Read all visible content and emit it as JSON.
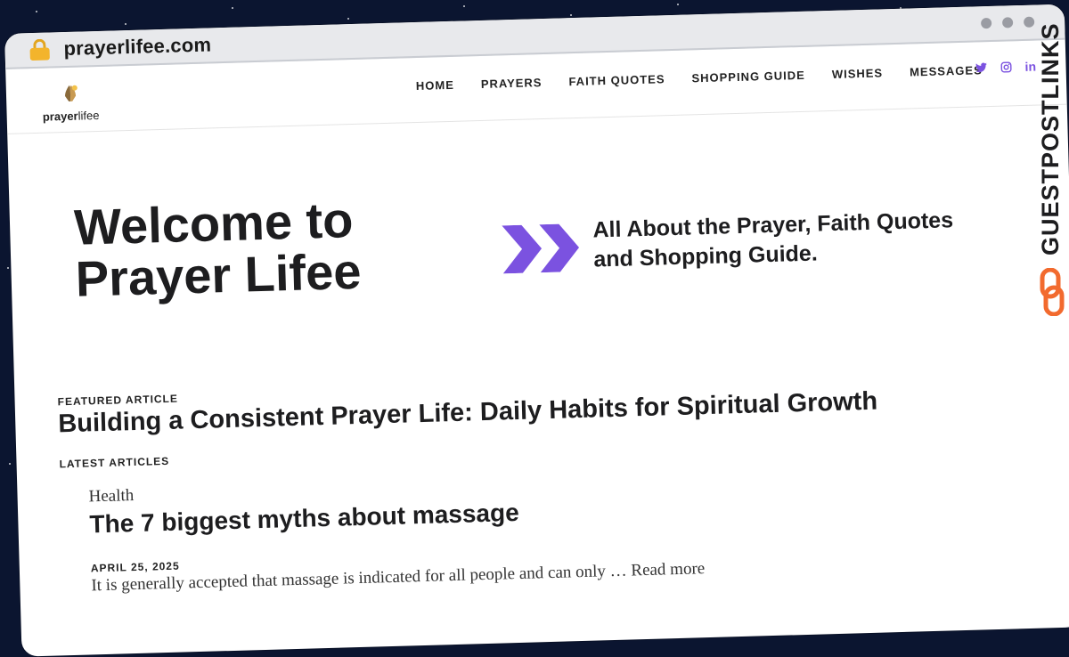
{
  "browser": {
    "url": "prayerlifee.com"
  },
  "header": {
    "logo_prefix": "prayer",
    "logo_suffix": "lifee",
    "nav": [
      {
        "label": "HOME"
      },
      {
        "label": "PRAYERS"
      },
      {
        "label": "FAITH QUOTES"
      },
      {
        "label": "SHOPPING GUIDE"
      },
      {
        "label": "WISHES"
      },
      {
        "label": "MESSAGES"
      }
    ],
    "social": [
      "twitter-icon",
      "instagram-icon",
      "linkedin-icon"
    ],
    "linkedin_label": "in"
  },
  "hero": {
    "title": "Welcome to Prayer Lifee",
    "subtitle": "All About the Prayer, Faith Quotes and Shopping Guide."
  },
  "featured": {
    "kicker": "FEATURED ARTICLE",
    "title": "Building a Consistent Prayer Life: Daily Habits for Spiritual Growth"
  },
  "latest": {
    "kicker": "LATEST ARTICLES",
    "articles": [
      {
        "category": "Health",
        "title": "The 7 biggest myths about massage",
        "date": "APRIL 25, 2025",
        "excerpt": "It is generally accepted that massage is indicated for all people and can only … ",
        "read_more": "Read more"
      }
    ]
  },
  "watermark": {
    "text": "GUESTPOSTLINKS"
  },
  "colors": {
    "accent": "#7b52e0",
    "watermark_orange": "#f26a2e",
    "lock": "#f3b42c"
  }
}
